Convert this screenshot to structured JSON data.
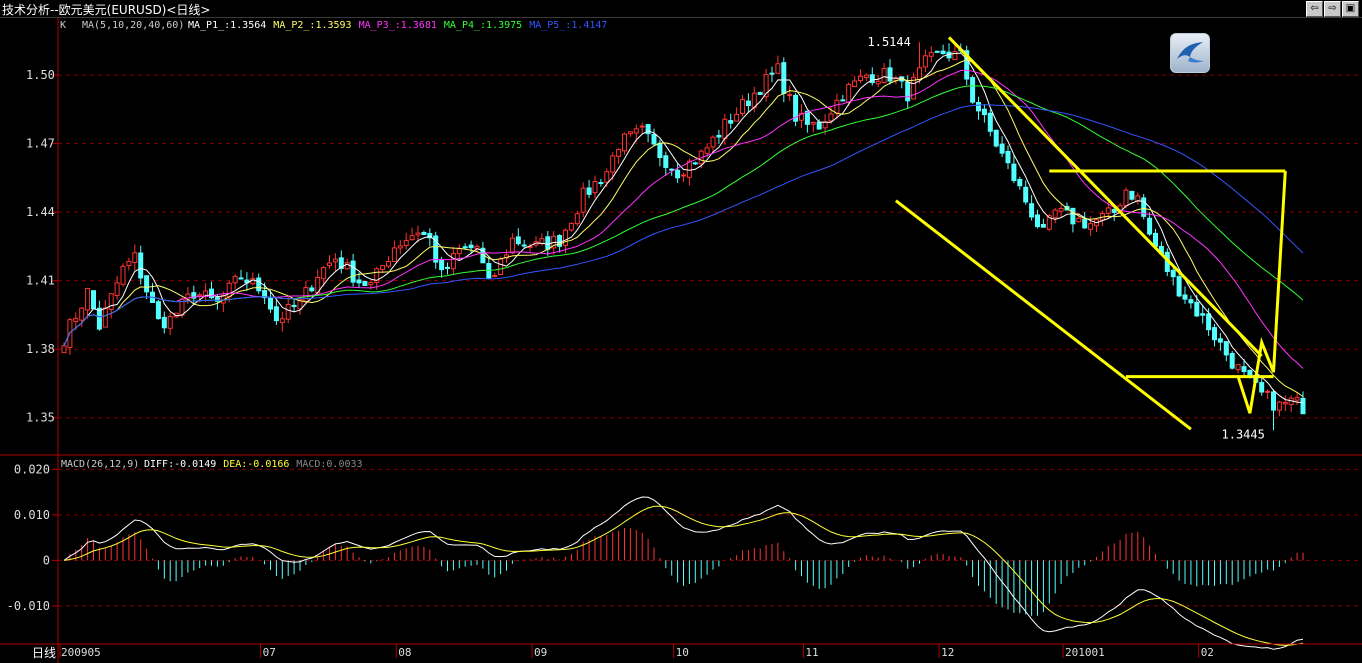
{
  "window": {
    "title": "技术分析--欧元美元(EURUSD)<日线>",
    "buttons": [
      "⇦",
      "⇨",
      "▣"
    ]
  },
  "main_legend": {
    "k_label": "K",
    "ma_params": "MA(5,10,20,40,60)",
    "items": [
      {
        "label": "MA_P1_:1.3564",
        "color": "#ffffff"
      },
      {
        "label": "MA_P2_:1.3593",
        "color": "#ffff66"
      },
      {
        "label": "MA_P3_:1.3681",
        "color": "#ff33ff"
      },
      {
        "label": "MA_P4_:1.3975",
        "color": "#33ff33"
      },
      {
        "label": "MA_P5_:1.4147",
        "color": "#3355ff"
      }
    ]
  },
  "macd_legend": {
    "params": "MACD(26,12,9)",
    "items": [
      {
        "label": "DIFF:-0.0149",
        "color": "#ffffff"
      },
      {
        "label": "DEA:-0.0166",
        "color": "#ffff33"
      },
      {
        "label": "MACD:0.0033",
        "color": "#888888"
      }
    ]
  },
  "annotations": {
    "high": "1.5144",
    "low": "1.3445"
  },
  "x_axis_label": "日线",
  "colors": {
    "up": "#ff3232",
    "down": "#54ffff",
    "grid": "#8b0000",
    "axis": "#b00000",
    "trend": "#ffff00"
  },
  "chart_data": [
    {
      "type": "candlestick",
      "title": "技术分析--欧元美元(EURUSD)<日线>",
      "ylim": [
        1.335,
        1.525
      ],
      "yticks": [
        "1.50",
        "1.47",
        "1.44",
        "1.41",
        "1.38",
        "1.35"
      ],
      "x_ticks": [
        {
          "label": "200905",
          "index": 0
        },
        {
          "label": "07",
          "index": 34
        },
        {
          "label": "08",
          "index": 57
        },
        {
          "label": "09",
          "index": 80
        },
        {
          "label": "10",
          "index": 104
        },
        {
          "label": "11",
          "index": 126
        },
        {
          "label": "12",
          "index": 149
        },
        {
          "label": "201001",
          "index": 170
        },
        {
          "label": "02",
          "index": 193
        }
      ],
      "close_waypoints": [
        [
          0,
          1.385
        ],
        [
          4,
          1.405
        ],
        [
          6,
          1.39
        ],
        [
          10,
          1.415
        ],
        [
          12,
          1.42
        ],
        [
          16,
          1.392
        ],
        [
          18,
          1.393
        ],
        [
          22,
          1.405
        ],
        [
          26,
          1.4
        ],
        [
          30,
          1.412
        ],
        [
          34,
          1.405
        ],
        [
          36,
          1.393
        ],
        [
          40,
          1.4
        ],
        [
          43,
          1.413
        ],
        [
          46,
          1.42
        ],
        [
          50,
          1.41
        ],
        [
          52,
          1.408
        ],
        [
          56,
          1.425
        ],
        [
          60,
          1.432
        ],
        [
          62,
          1.428
        ],
        [
          64,
          1.412
        ],
        [
          67,
          1.423
        ],
        [
          70,
          1.425
        ],
        [
          72,
          1.408
        ],
        [
          76,
          1.428
        ],
        [
          80,
          1.425
        ],
        [
          84,
          1.428
        ],
        [
          88,
          1.447
        ],
        [
          92,
          1.458
        ],
        [
          94,
          1.47
        ],
        [
          98,
          1.475
        ],
        [
          100,
          1.468
        ],
        [
          104,
          1.458
        ],
        [
          108,
          1.465
        ],
        [
          112,
          1.478
        ],
        [
          118,
          1.495
        ],
        [
          121,
          1.502
        ],
        [
          124,
          1.482
        ],
        [
          126,
          1.478
        ],
        [
          128,
          1.478
        ],
        [
          132,
          1.492
        ],
        [
          136,
          1.5
        ],
        [
          140,
          1.5
        ],
        [
          143,
          1.492
        ],
        [
          146,
          1.505
        ],
        [
          149,
          1.51
        ],
        [
          152,
          1.508
        ],
        [
          154,
          1.49
        ],
        [
          156,
          1.48
        ],
        [
          158,
          1.47
        ],
        [
          161,
          1.455
        ],
        [
          164,
          1.44
        ],
        [
          166,
          1.43
        ],
        [
          168,
          1.44
        ],
        [
          171,
          1.437
        ],
        [
          174,
          1.435
        ],
        [
          178,
          1.44
        ],
        [
          180,
          1.45
        ],
        [
          182,
          1.446
        ],
        [
          184,
          1.43
        ],
        [
          186,
          1.42
        ],
        [
          188,
          1.41
        ],
        [
          191,
          1.4
        ],
        [
          194,
          1.39
        ],
        [
          197,
          1.378
        ],
        [
          200,
          1.368
        ],
        [
          203,
          1.36
        ],
        [
          206,
          1.355
        ],
        [
          208,
          1.357
        ],
        [
          210,
          1.355
        ]
      ],
      "high": {
        "value": 1.5144,
        "index": 145
      },
      "low": {
        "value": 1.3445,
        "index": 205
      },
      "moving_averages": [
        {
          "name": "MA_P1_",
          "period": 5,
          "last": 1.3564
        },
        {
          "name": "MA_P2_",
          "period": 10,
          "last": 1.3593
        },
        {
          "name": "MA_P3_",
          "period": 20,
          "last": 1.3681
        },
        {
          "name": "MA_P4_",
          "period": 40,
          "last": 1.3975
        },
        {
          "name": "MA_P5_",
          "period": 60,
          "last": 1.4147
        }
      ],
      "trend_lines": [
        {
          "points": [
            [
              150,
              1.5165
            ],
            [
              203,
              1.377
            ]
          ]
        },
        {
          "points": [
            [
              141,
              1.445
            ],
            [
              191,
              1.345
            ]
          ]
        },
        {
          "points": [
            [
              167,
              1.458
            ],
            [
              207,
              1.458
            ]
          ]
        },
        {
          "points": [
            [
              180,
              1.368
            ],
            [
              205,
              1.368
            ]
          ]
        },
        {
          "points": [
            [
              199,
              1.368
            ],
            [
              201,
              1.352
            ],
            [
              203,
              1.383
            ],
            [
              205,
              1.37
            ],
            [
              207,
              1.458
            ]
          ]
        }
      ]
    },
    {
      "type": "macd",
      "params": "MACD(26,12,9)",
      "yticks": [
        "0.020",
        "0.010",
        "0",
        "-0.010"
      ],
      "ylim": [
        -0.0175,
        0.0225
      ],
      "diff_last": -0.0149,
      "dea_last": -0.0166,
      "macd_last": 0.0033
    }
  ]
}
